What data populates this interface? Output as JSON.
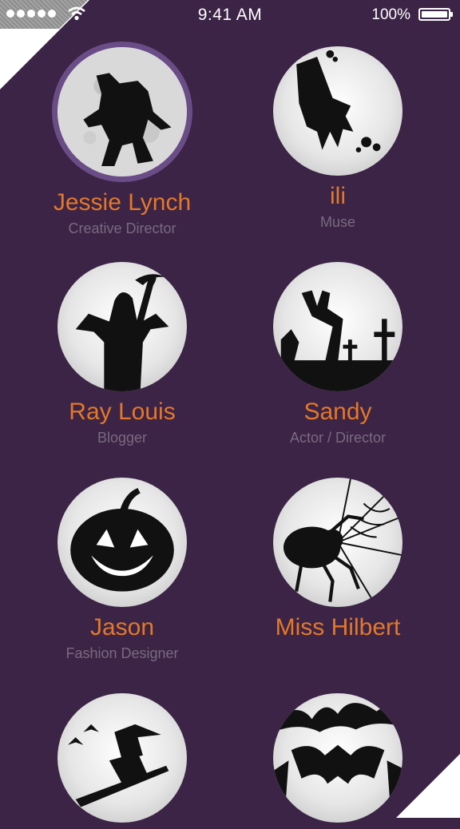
{
  "status_bar": {
    "time": "9:41 AM",
    "battery": "100%",
    "signal_icon": "signal-dots-icon",
    "wifi_icon": "wifi-icon",
    "battery_icon": "battery-icon"
  },
  "colors": {
    "background": "#3b2445",
    "name": "#e3782a",
    "role": "#7a6a82",
    "selected_ring": "#6a4c86"
  },
  "profiles": [
    {
      "name": "Jessie Lynch",
      "role": "Creative Director",
      "icon": "werewolf-moon-icon",
      "selected": true
    },
    {
      "name": "ili",
      "role": "Muse",
      "icon": "bloody-hand-icon",
      "selected": false
    },
    {
      "name": "Ray Louis",
      "role": "Blogger",
      "icon": "grim-reaper-icon",
      "selected": false
    },
    {
      "name": "Sandy",
      "role": "Actor / Director",
      "icon": "zombie-graveyard-icon",
      "selected": false
    },
    {
      "name": "Jason",
      "role": "Fashion Designer",
      "icon": "jack-o-lantern-icon",
      "selected": false
    },
    {
      "name": "Miss Hilbert",
      "role": "",
      "icon": "spider-web-icon",
      "selected": false
    },
    {
      "name": "",
      "role": "",
      "icon": "witch-broom-icon",
      "selected": false
    },
    {
      "name": "",
      "role": "",
      "icon": "bat-tree-icon",
      "selected": false
    }
  ]
}
